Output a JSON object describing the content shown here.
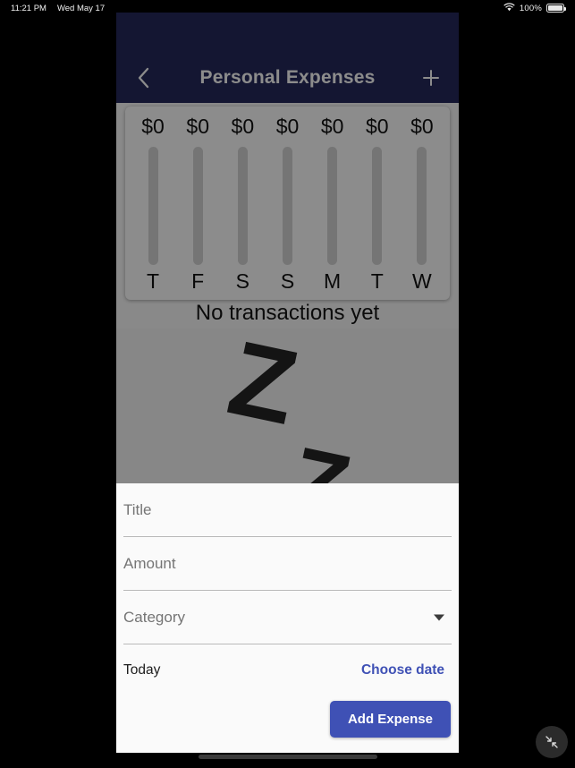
{
  "status_bar": {
    "time": "11:21 PM",
    "date": "Wed May 17",
    "battery_percent": "100%",
    "wifi_icon": "wifi-icon",
    "battery_icon": "battery-full-icon"
  },
  "app_bar": {
    "title": "Personal Expenses",
    "back_icon": "chevron-left-icon",
    "add_icon": "plus-icon",
    "background_color": "#26295c"
  },
  "chart": {
    "bars": [
      {
        "amount": "$0",
        "day": "T"
      },
      {
        "amount": "$0",
        "day": "F"
      },
      {
        "amount": "$0",
        "day": "S"
      },
      {
        "amount": "$0",
        "day": "S"
      },
      {
        "amount": "$0",
        "day": "M"
      },
      {
        "amount": "$0",
        "day": "T"
      },
      {
        "amount": "$0",
        "day": "W"
      }
    ]
  },
  "chart_data": {
    "type": "bar",
    "title": "",
    "categories": [
      "T",
      "F",
      "S",
      "S",
      "M",
      "T",
      "W"
    ],
    "values": [
      0,
      0,
      0,
      0,
      0,
      0,
      0
    ],
    "data_labels": [
      "$0",
      "$0",
      "$0",
      "$0",
      "$0",
      "$0",
      "$0"
    ],
    "xlabel": "",
    "ylabel": "",
    "ylim": [
      0,
      100
    ],
    "grid": false,
    "legend": "none",
    "bar_color": "#3f51b5",
    "track_color": "#d6d6d6"
  },
  "empty_state": {
    "title": "No transactions yet",
    "illustration": "sleeping-zzz-illustration",
    "z_letters": [
      "Z",
      "Z"
    ]
  },
  "sheet": {
    "title_field": {
      "label": "Title",
      "value": "",
      "placeholder": "Title"
    },
    "amount_field": {
      "label": "Amount",
      "value": "",
      "placeholder": "Amount"
    },
    "category_field": {
      "label": "Category",
      "value": "Category",
      "dropdown_icon": "chevron-down-icon"
    },
    "date_row": {
      "date_text": "Today",
      "choose_date_label": "Choose date",
      "link_color": "#3f51b5"
    },
    "submit_label": "Add Expense",
    "submit_color": "#3f51b5"
  },
  "overlay_controls": {
    "collapse_icon": "collapse-arrows-icon"
  }
}
